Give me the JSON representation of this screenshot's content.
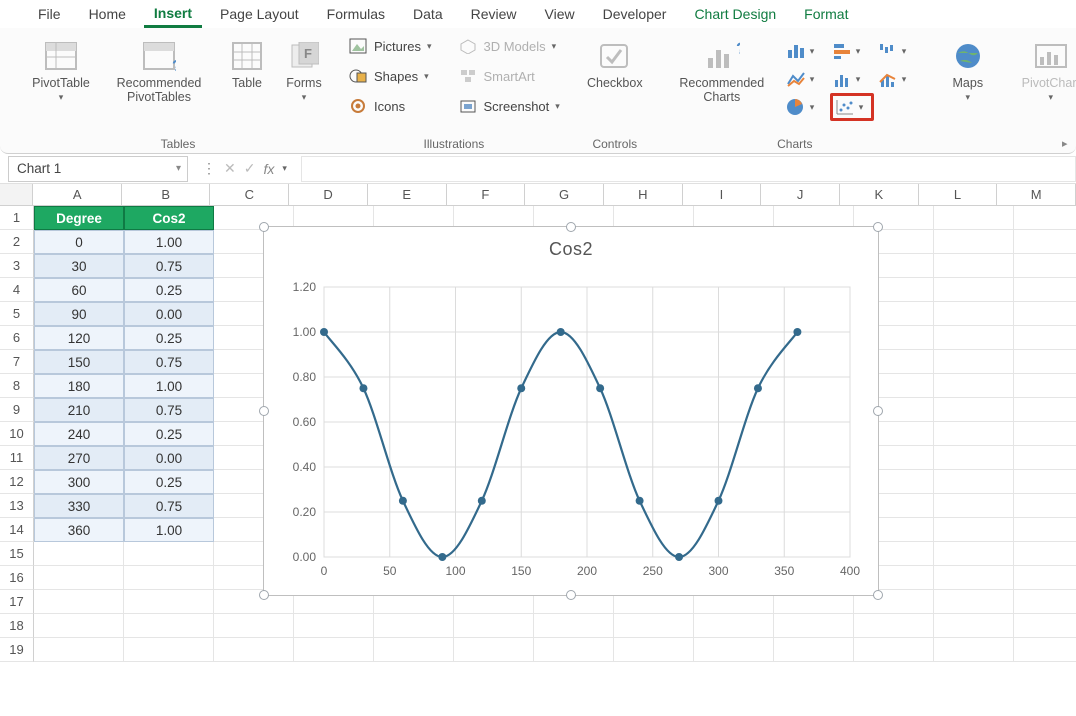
{
  "tabs": {
    "file": "File",
    "home": "Home",
    "insert": "Insert",
    "page_layout": "Page Layout",
    "formulas": "Formulas",
    "data": "Data",
    "review": "Review",
    "view": "View",
    "developer": "Developer",
    "chart_design": "Chart Design",
    "format": "Format"
  },
  "ribbon": {
    "tables": {
      "pivottable": "PivotTable",
      "recommended_pivottables": "Recommended PivotTables",
      "table": "Table",
      "forms": "Forms",
      "group": "Tables"
    },
    "illustrations": {
      "pictures": "Pictures",
      "shapes": "Shapes",
      "icons": "Icons",
      "models3d": "3D Models",
      "smartart": "SmartArt",
      "screenshot": "Screenshot",
      "group": "Illustrations"
    },
    "controls": {
      "checkbox": "Checkbox",
      "group": "Controls"
    },
    "charts": {
      "recommended": "Recommended Charts",
      "group": "Charts"
    },
    "maps": {
      "label": "Maps"
    },
    "pivotchart": {
      "label": "PivotChart"
    }
  },
  "namebox": "Chart 1",
  "colhdrs": [
    "A",
    "B",
    "C",
    "D",
    "E",
    "F",
    "G",
    "H",
    "I",
    "J",
    "K",
    "L",
    "M"
  ],
  "rowcount": 19,
  "table": {
    "headers": [
      "Degree",
      "Cos2"
    ],
    "rows": [
      [
        "0",
        "1.00"
      ],
      [
        "30",
        "0.75"
      ],
      [
        "60",
        "0.25"
      ],
      [
        "90",
        "0.00"
      ],
      [
        "120",
        "0.25"
      ],
      [
        "150",
        "0.75"
      ],
      [
        "180",
        "1.00"
      ],
      [
        "210",
        "0.75"
      ],
      [
        "240",
        "0.25"
      ],
      [
        "270",
        "0.00"
      ],
      [
        "300",
        "0.25"
      ],
      [
        "330",
        "0.75"
      ],
      [
        "360",
        "1.00"
      ]
    ]
  },
  "chart_data": {
    "type": "scatter",
    "title": "Cos2",
    "xlabel": "",
    "ylabel": "",
    "x": [
      0,
      30,
      60,
      90,
      120,
      150,
      180,
      210,
      240,
      270,
      300,
      330,
      360
    ],
    "y": [
      1.0,
      0.75,
      0.25,
      0.0,
      0.25,
      0.75,
      1.0,
      0.75,
      0.25,
      0.0,
      0.25,
      0.75,
      1.0
    ],
    "xlim": [
      0,
      400
    ],
    "ylim": [
      0.0,
      1.2
    ],
    "xticks": [
      0,
      50,
      100,
      150,
      200,
      250,
      300,
      350,
      400
    ],
    "yticks": [
      0.0,
      0.2,
      0.4,
      0.6,
      0.8,
      1.0,
      1.2
    ],
    "series_color": "#336a8c",
    "marker": "circle",
    "smooth_line": true,
    "grid": true
  }
}
